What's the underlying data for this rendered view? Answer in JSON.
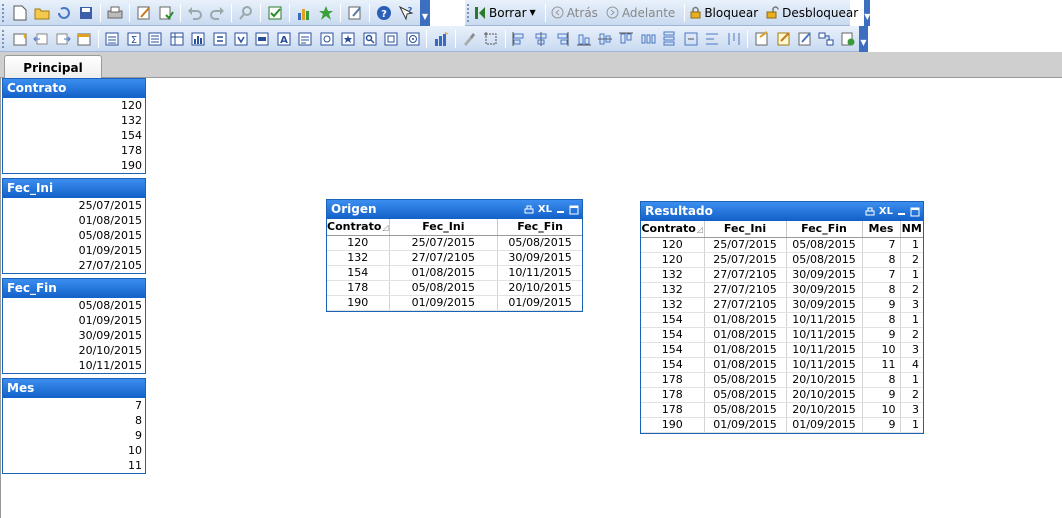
{
  "toolbar": {
    "clear_label": "Borrar",
    "back_label": "Atrás",
    "forward_label": "Adelante",
    "lock_label": "Bloquear",
    "unlock_label": "Desbloquear"
  },
  "tabs": [
    {
      "label": "Principal"
    }
  ],
  "listboxes": [
    {
      "title": "Contrato",
      "items": [
        "120",
        "132",
        "154",
        "178",
        "190"
      ]
    },
    {
      "title": "Fec_Ini",
      "items": [
        "25/07/2015",
        "01/08/2015",
        "05/08/2015",
        "01/09/2015",
        "27/07/2105"
      ]
    },
    {
      "title": "Fec_Fin",
      "items": [
        "05/08/2015",
        "01/09/2015",
        "30/09/2015",
        "20/10/2015",
        "10/11/2015"
      ]
    },
    {
      "title": "Mes",
      "items": [
        "7",
        "8",
        "9",
        "10",
        "11"
      ]
    }
  ],
  "origen": {
    "title": "Origen",
    "xl_label": "XL",
    "columns": [
      "Contrato",
      "Fec_Ini",
      "Fec_Fin"
    ],
    "rows": [
      [
        "120",
        "25/07/2015",
        "05/08/2015"
      ],
      [
        "132",
        "27/07/2105",
        "30/09/2015"
      ],
      [
        "154",
        "01/08/2015",
        "10/11/2015"
      ],
      [
        "178",
        "05/08/2015",
        "20/10/2015"
      ],
      [
        "190",
        "01/09/2015",
        "01/09/2015"
      ]
    ]
  },
  "resultado": {
    "title": "Resultado",
    "xl_label": "XL",
    "columns": [
      "Contrato",
      "Fec_Ini",
      "Fec_Fin",
      "Mes",
      "NM"
    ],
    "rows": [
      [
        "120",
        "25/07/2015",
        "05/08/2015",
        "7",
        "1"
      ],
      [
        "120",
        "25/07/2015",
        "05/08/2015",
        "8",
        "2"
      ],
      [
        "132",
        "27/07/2105",
        "30/09/2015",
        "7",
        "1"
      ],
      [
        "132",
        "27/07/2105",
        "30/09/2015",
        "8",
        "2"
      ],
      [
        "132",
        "27/07/2105",
        "30/09/2015",
        "9",
        "3"
      ],
      [
        "154",
        "01/08/2015",
        "10/11/2015",
        "8",
        "1"
      ],
      [
        "154",
        "01/08/2015",
        "10/11/2015",
        "9",
        "2"
      ],
      [
        "154",
        "01/08/2015",
        "10/11/2015",
        "10",
        "3"
      ],
      [
        "154",
        "01/08/2015",
        "10/11/2015",
        "11",
        "4"
      ],
      [
        "178",
        "05/08/2015",
        "20/10/2015",
        "8",
        "1"
      ],
      [
        "178",
        "05/08/2015",
        "20/10/2015",
        "9",
        "2"
      ],
      [
        "178",
        "05/08/2015",
        "20/10/2015",
        "10",
        "3"
      ],
      [
        "190",
        "01/09/2015",
        "01/09/2015",
        "9",
        "1"
      ]
    ]
  },
  "colors": {
    "caption_blue": "#1260c8",
    "toolbar_bg": "#c9daf0"
  }
}
